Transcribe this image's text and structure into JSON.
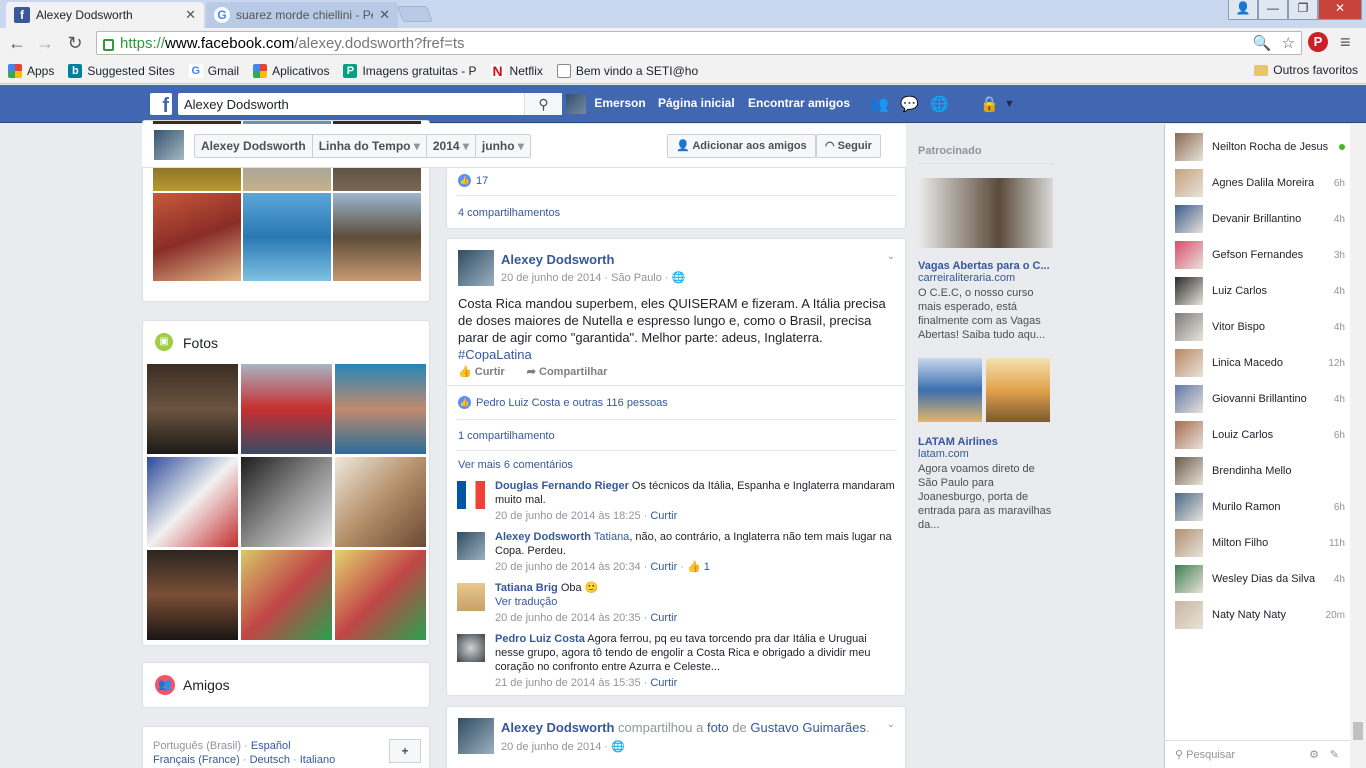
{
  "browser": {
    "tabs": [
      {
        "title": "Alexey Dodsworth",
        "active": true
      },
      {
        "title": "suarez morde chiellini - Pe",
        "active": false
      }
    ],
    "url": {
      "scheme": "https://",
      "host": "www.facebook.com",
      "path": "/alexey.dodsworth?fref=ts"
    },
    "bookmarks": [
      "Apps",
      "Suggested Sites",
      "Gmail",
      "Aplicativos",
      "Imagens gratuitas - P",
      "Netflix",
      "Bem vindo a SETI@ho"
    ],
    "other_bookmarks": "Outros favoritos"
  },
  "fb": {
    "search_value": "Alexey Dodsworth",
    "user": "Emerson",
    "home": "Página inicial",
    "find_friends": "Encontrar amigos"
  },
  "timeline": {
    "name": "Alexey Dodsworth",
    "section": "Linha do Tempo",
    "year": "2014",
    "month": "junho",
    "add_friend": "Adicionar aos amigos",
    "follow": "Seguir"
  },
  "left": {
    "photos_title": "Fotos",
    "friends_title": "Amigos",
    "languages": [
      "Português (Brasil)",
      "Español",
      "Français (France)",
      "Deutsch",
      "Italiano"
    ]
  },
  "post0": {
    "likes": "17",
    "shares": "4 compartilhamentos"
  },
  "post1": {
    "author": "Alexey Dodsworth",
    "date": "20 de junho de 2014",
    "place": "São Paulo",
    "text": "Costa Rica mandou superbem, eles QUISERAM e fizeram. A Itália precisa de doses maiores de Nutella e espresso lungo e, como o Brasil, precisa parar de agir como \"garantida\". Melhor parte: adeus, Inglaterra.",
    "hashtag": "#CopaLatina",
    "like_label": "Curtir",
    "share_label": "Compartilhar",
    "likes": "Pedro Luiz Costa e outras 116 pessoas",
    "shares": "1 compartilhamento",
    "more_comments": "Ver mais 6 comentários",
    "comments": [
      {
        "name": "Douglas Fernando Rieger",
        "text": "Os técnicos da Itália, Espanha e Inglaterra mandaram muito mal.",
        "time": "20 de junho de 2014 às 18:25",
        "action": "Curtir",
        "likes": ""
      },
      {
        "name": "Alexey Dodsworth",
        "tag": "Tatiana",
        "text": ", não, ao contrário, a Inglaterra não tem mais lugar na Copa. Perdeu.",
        "time": "20 de junho de 2014 às 20:34",
        "action": "Curtir",
        "likes": "1"
      },
      {
        "name": "Tatiana Brig",
        "text": "Oba",
        "translate": "Ver tradução",
        "time": "20 de junho de 2014 às 20:35",
        "action": "Curtir",
        "likes": ""
      },
      {
        "name": "Pedro Luiz Costa",
        "text": "Agora ferrou, pq eu tava torcendo pra dar Itália e Uruguai nesse grupo, agora tô tendo de engolir a Costa Rica e obrigado a dividir meu coração no confronto entre Azurra e Celeste...",
        "time": "21 de junho de 2014 às 15:35",
        "action": "Curtir",
        "likes": ""
      }
    ]
  },
  "post2": {
    "author": "Alexey Dodsworth",
    "shared": "compartilhou a",
    "photo": "foto",
    "of": "de",
    "source": "Gustavo Guimarães",
    "date": "20 de junho de 2014"
  },
  "ads": {
    "label": "Patrocinado",
    "items": [
      {
        "title": "Vagas Abertas para o C...",
        "host": "carreiraliteraria.com",
        "body": "O C.E.C, o nosso curso mais esperado, está finalmente com as Vagas Abertas! Saiba tudo aqu..."
      },
      {
        "title": "LATAM Airlines",
        "host": "latam.com",
        "body": "Agora voamos direto de São Paulo para Joanesburgo, porta de entrada para as maravilhas da..."
      }
    ]
  },
  "chat": {
    "contacts": [
      {
        "name": "Neilton Rocha de Jesus",
        "time": "",
        "online": true
      },
      {
        "name": "Agnes Dalila Moreira",
        "time": "6h"
      },
      {
        "name": "Devanir Brillantino",
        "time": "4h"
      },
      {
        "name": "Gefson Fernandes",
        "time": "3h"
      },
      {
        "name": "Luiz Carlos",
        "time": "4h"
      },
      {
        "name": "Vitor Bispo",
        "time": "4h"
      },
      {
        "name": "Linica Macedo",
        "time": "12h"
      },
      {
        "name": "Giovanni Brillantino",
        "time": "4h"
      },
      {
        "name": "Louiz Carlos",
        "time": "6h"
      },
      {
        "name": "Brendinha Mello",
        "time": ""
      },
      {
        "name": "Murilo Ramon",
        "time": "6h"
      },
      {
        "name": "Milton Filho",
        "time": "11h"
      },
      {
        "name": "Wesley Dias da Silva",
        "time": "4h"
      },
      {
        "name": "Naty Naty Naty",
        "time": "20m"
      }
    ],
    "search_placeholder": "Pesquisar"
  }
}
